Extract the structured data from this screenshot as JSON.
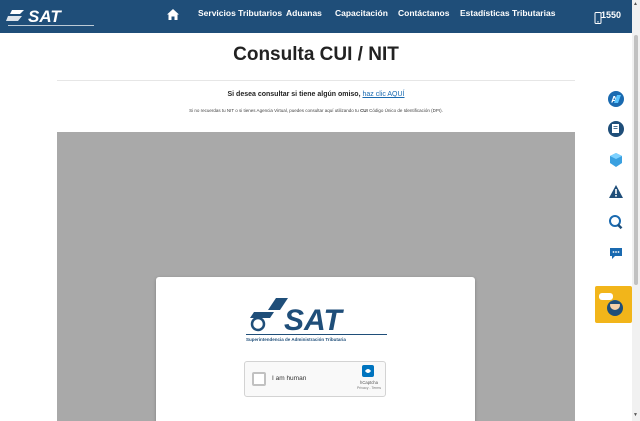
{
  "header": {
    "logo_text": "SAT",
    "logo_subtext": "Superintendencia de Administración Tributaria",
    "nav": [
      {
        "label": "Servicios Tributarios"
      },
      {
        "label": "Aduanas"
      },
      {
        "label": "Capacitación"
      },
      {
        "label": "Contáctanos"
      },
      {
        "label": "Estadísticas Tributarias"
      }
    ],
    "phone": "1550",
    "colors": {
      "bar": "#1f4e79",
      "text": "#ffffff"
    }
  },
  "main": {
    "title": "Consulta CUI / NIT",
    "line1_prefix": "Si desea consultar si tiene algún omiso,",
    "line1_link": "haz clic AQUÍ",
    "line2_a": "Si no recuerdas tu NIT o si tienes Agencia Virtual, puedes consultar aquí utilizando tu",
    "line2_bold": "CUI",
    "line2_b": "Código Único de Identificación (DPI)."
  },
  "card": {
    "logo_text": "SAT",
    "logo_subtext": "Superintendencia de Administración Tributaria",
    "captcha_label": "I am human",
    "captcha_brand": "hCaptcha",
    "captcha_terms": "Privacy - Terms"
  },
  "side_icons": [
    "agencia-virtual-icon",
    "document-icon",
    "package-icon",
    "warning-icon",
    "search-icon",
    "chat-bubble-icon"
  ],
  "colors": {
    "accent": "#1a6ab0",
    "chat_widget": "#f2b51a",
    "frame": "#a9a9a9"
  }
}
